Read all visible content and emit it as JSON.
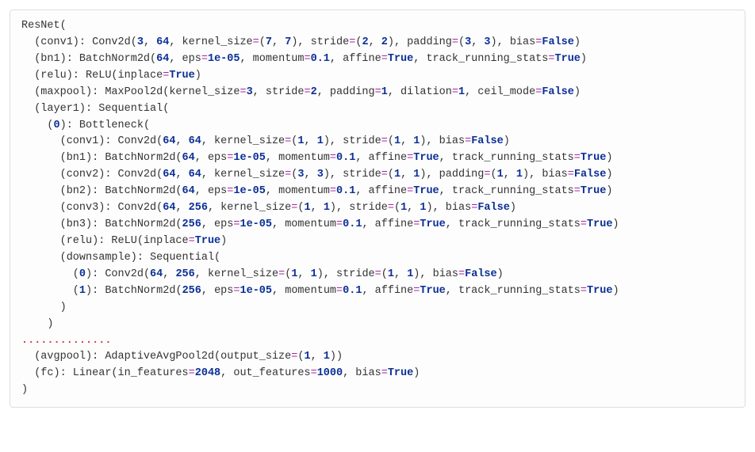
{
  "model": "ResNet",
  "lines": [
    {
      "indent": 0,
      "tokens": [
        [
          "ResNet(",
          ""
        ]
      ]
    },
    {
      "indent": 1,
      "tokens": [
        [
          "(conv1): Conv2d(",
          ""
        ],
        [
          "3",
          "n"
        ],
        [
          ", ",
          ""
        ],
        [
          "64",
          "n"
        ],
        [
          ", kernel_size",
          ""
        ],
        [
          "=",
          "op"
        ],
        [
          "(",
          ""
        ],
        [
          "7",
          "n"
        ],
        [
          ", ",
          ""
        ],
        [
          "7",
          "n"
        ],
        [
          "), stride",
          ""
        ],
        [
          "=",
          "op"
        ],
        [
          "(",
          ""
        ],
        [
          "2",
          "n"
        ],
        [
          ", ",
          ""
        ],
        [
          "2",
          "n"
        ],
        [
          "), padding",
          ""
        ],
        [
          "=",
          "op"
        ],
        [
          "(",
          ""
        ],
        [
          "3",
          "n"
        ],
        [
          ", ",
          ""
        ],
        [
          "3",
          "n"
        ],
        [
          "), bias",
          ""
        ],
        [
          "=",
          "op"
        ],
        [
          "False",
          "kw"
        ],
        [
          ")",
          ""
        ]
      ]
    },
    {
      "indent": 1,
      "tokens": [
        [
          "(bn1): BatchNorm2d(",
          ""
        ],
        [
          "64",
          "n"
        ],
        [
          ", eps",
          ""
        ],
        [
          "=",
          "op"
        ],
        [
          "1e-05",
          "n"
        ],
        [
          ", momentum",
          ""
        ],
        [
          "=",
          "op"
        ],
        [
          "0.1",
          "n"
        ],
        [
          ", affine",
          ""
        ],
        [
          "=",
          "op"
        ],
        [
          "True",
          "kw"
        ],
        [
          ", track_running_stats",
          ""
        ],
        [
          "=",
          "op"
        ],
        [
          "True",
          "kw"
        ],
        [
          ")",
          ""
        ]
      ]
    },
    {
      "indent": 1,
      "tokens": [
        [
          "(relu): ReLU(inplace",
          ""
        ],
        [
          "=",
          "op"
        ],
        [
          "True",
          "kw"
        ],
        [
          ")",
          ""
        ]
      ]
    },
    {
      "indent": 1,
      "tokens": [
        [
          "(maxpool): MaxPool2d(kernel_size",
          ""
        ],
        [
          "=",
          "op"
        ],
        [
          "3",
          "n"
        ],
        [
          ", stride",
          ""
        ],
        [
          "=",
          "op"
        ],
        [
          "2",
          "n"
        ],
        [
          ", padding",
          ""
        ],
        [
          "=",
          "op"
        ],
        [
          "1",
          "n"
        ],
        [
          ", dilation",
          ""
        ],
        [
          "=",
          "op"
        ],
        [
          "1",
          "n"
        ],
        [
          ", ceil_mode",
          ""
        ],
        [
          "=",
          "op"
        ],
        [
          "False",
          "kw"
        ],
        [
          ")",
          ""
        ]
      ]
    },
    {
      "indent": 1,
      "tokens": [
        [
          "(layer1): Sequential(",
          ""
        ]
      ]
    },
    {
      "indent": 2,
      "tokens": [
        [
          "(",
          ""
        ],
        [
          "0",
          "n"
        ],
        [
          "): Bottleneck(",
          ""
        ]
      ]
    },
    {
      "indent": 3,
      "tokens": [
        [
          "(conv1): Conv2d(",
          ""
        ],
        [
          "64",
          "n"
        ],
        [
          ", ",
          ""
        ],
        [
          "64",
          "n"
        ],
        [
          ", kernel_size",
          ""
        ],
        [
          "=",
          "op"
        ],
        [
          "(",
          ""
        ],
        [
          "1",
          "n"
        ],
        [
          ", ",
          ""
        ],
        [
          "1",
          "n"
        ],
        [
          "), stride",
          ""
        ],
        [
          "=",
          "op"
        ],
        [
          "(",
          ""
        ],
        [
          "1",
          "n"
        ],
        [
          ", ",
          ""
        ],
        [
          "1",
          "n"
        ],
        [
          "), bias",
          ""
        ],
        [
          "=",
          "op"
        ],
        [
          "False",
          "kw"
        ],
        [
          ")",
          ""
        ]
      ]
    },
    {
      "indent": 3,
      "tokens": [
        [
          "(bn1): BatchNorm2d(",
          ""
        ],
        [
          "64",
          "n"
        ],
        [
          ", eps",
          ""
        ],
        [
          "=",
          "op"
        ],
        [
          "1e-05",
          "n"
        ],
        [
          ", momentum",
          ""
        ],
        [
          "=",
          "op"
        ],
        [
          "0.1",
          "n"
        ],
        [
          ", affine",
          ""
        ],
        [
          "=",
          "op"
        ],
        [
          "True",
          "kw"
        ],
        [
          ", track_running_stats",
          ""
        ],
        [
          "=",
          "op"
        ],
        [
          "True",
          "kw"
        ],
        [
          ")",
          ""
        ]
      ]
    },
    {
      "indent": 3,
      "tokens": [
        [
          "(conv2): Conv2d(",
          ""
        ],
        [
          "64",
          "n"
        ],
        [
          ", ",
          ""
        ],
        [
          "64",
          "n"
        ],
        [
          ", kernel_size",
          ""
        ],
        [
          "=",
          "op"
        ],
        [
          "(",
          ""
        ],
        [
          "3",
          "n"
        ],
        [
          ", ",
          ""
        ],
        [
          "3",
          "n"
        ],
        [
          "), stride",
          ""
        ],
        [
          "=",
          "op"
        ],
        [
          "(",
          ""
        ],
        [
          "1",
          "n"
        ],
        [
          ", ",
          ""
        ],
        [
          "1",
          "n"
        ],
        [
          "), padding",
          ""
        ],
        [
          "=",
          "op"
        ],
        [
          "(",
          ""
        ],
        [
          "1",
          "n"
        ],
        [
          ", ",
          ""
        ],
        [
          "1",
          "n"
        ],
        [
          "), bias",
          ""
        ],
        [
          "=",
          "op"
        ],
        [
          "False",
          "kw"
        ],
        [
          ")",
          ""
        ]
      ]
    },
    {
      "indent": 3,
      "tokens": [
        [
          "(bn2): BatchNorm2d(",
          ""
        ],
        [
          "64",
          "n"
        ],
        [
          ", eps",
          ""
        ],
        [
          "=",
          "op"
        ],
        [
          "1e-05",
          "n"
        ],
        [
          ", momentum",
          ""
        ],
        [
          "=",
          "op"
        ],
        [
          "0.1",
          "n"
        ],
        [
          ", affine",
          ""
        ],
        [
          "=",
          "op"
        ],
        [
          "True",
          "kw"
        ],
        [
          ", track_running_stats",
          ""
        ],
        [
          "=",
          "op"
        ],
        [
          "True",
          "kw"
        ],
        [
          ")",
          ""
        ]
      ]
    },
    {
      "indent": 3,
      "tokens": [
        [
          "(conv3): Conv2d(",
          ""
        ],
        [
          "64",
          "n"
        ],
        [
          ", ",
          ""
        ],
        [
          "256",
          "n"
        ],
        [
          ", kernel_size",
          ""
        ],
        [
          "=",
          "op"
        ],
        [
          "(",
          ""
        ],
        [
          "1",
          "n"
        ],
        [
          ", ",
          ""
        ],
        [
          "1",
          "n"
        ],
        [
          "), stride",
          ""
        ],
        [
          "=",
          "op"
        ],
        [
          "(",
          ""
        ],
        [
          "1",
          "n"
        ],
        [
          ", ",
          ""
        ],
        [
          "1",
          "n"
        ],
        [
          "), bias",
          ""
        ],
        [
          "=",
          "op"
        ],
        [
          "False",
          "kw"
        ],
        [
          ")",
          ""
        ]
      ]
    },
    {
      "indent": 3,
      "tokens": [
        [
          "(bn3): BatchNorm2d(",
          ""
        ],
        [
          "256",
          "n"
        ],
        [
          ", eps",
          ""
        ],
        [
          "=",
          "op"
        ],
        [
          "1e-05",
          "n"
        ],
        [
          ", momentum",
          ""
        ],
        [
          "=",
          "op"
        ],
        [
          "0.1",
          "n"
        ],
        [
          ", affine",
          ""
        ],
        [
          "=",
          "op"
        ],
        [
          "True",
          "kw"
        ],
        [
          ", track_running_stats",
          ""
        ],
        [
          "=",
          "op"
        ],
        [
          "True",
          "kw"
        ],
        [
          ")",
          ""
        ]
      ]
    },
    {
      "indent": 3,
      "tokens": [
        [
          "(relu): ReLU(inplace",
          ""
        ],
        [
          "=",
          "op"
        ],
        [
          "True",
          "kw"
        ],
        [
          ")",
          ""
        ]
      ]
    },
    {
      "indent": 3,
      "tokens": [
        [
          "(downsample): Sequential(",
          ""
        ]
      ]
    },
    {
      "indent": 4,
      "tokens": [
        [
          "(",
          ""
        ],
        [
          "0",
          "n"
        ],
        [
          "): Conv2d(",
          ""
        ],
        [
          "64",
          "n"
        ],
        [
          ", ",
          ""
        ],
        [
          "256",
          "n"
        ],
        [
          ", kernel_size",
          ""
        ],
        [
          "=",
          "op"
        ],
        [
          "(",
          ""
        ],
        [
          "1",
          "n"
        ],
        [
          ", ",
          ""
        ],
        [
          "1",
          "n"
        ],
        [
          "), stride",
          ""
        ],
        [
          "=",
          "op"
        ],
        [
          "(",
          ""
        ],
        [
          "1",
          "n"
        ],
        [
          ", ",
          ""
        ],
        [
          "1",
          "n"
        ],
        [
          "), bias",
          ""
        ],
        [
          "=",
          "op"
        ],
        [
          "False",
          "kw"
        ],
        [
          ")",
          ""
        ]
      ]
    },
    {
      "indent": 4,
      "tokens": [
        [
          "(",
          ""
        ],
        [
          "1",
          "n"
        ],
        [
          "): BatchNorm2d(",
          ""
        ],
        [
          "256",
          "n"
        ],
        [
          ", eps",
          ""
        ],
        [
          "=",
          "op"
        ],
        [
          "1e-05",
          "n"
        ],
        [
          ", momentum",
          ""
        ],
        [
          "=",
          "op"
        ],
        [
          "0.1",
          "n"
        ],
        [
          ", affine",
          ""
        ],
        [
          "=",
          "op"
        ],
        [
          "True",
          "kw"
        ],
        [
          ", track_running_stats",
          ""
        ],
        [
          "=",
          "op"
        ],
        [
          "True",
          "kw"
        ],
        [
          ")",
          ""
        ]
      ]
    },
    {
      "indent": 3,
      "tokens": [
        [
          ")",
          ""
        ]
      ]
    },
    {
      "indent": 2,
      "tokens": [
        [
          ")",
          ""
        ]
      ]
    },
    {
      "indent": 0,
      "tokens": [
        [
          "..............",
          "dots"
        ]
      ]
    },
    {
      "indent": 1,
      "tokens": [
        [
          "(avgpool): AdaptiveAvgPool2d(output_size",
          ""
        ],
        [
          "=",
          "op"
        ],
        [
          "(",
          ""
        ],
        [
          "1",
          "n"
        ],
        [
          ", ",
          ""
        ],
        [
          "1",
          "n"
        ],
        [
          "))",
          ""
        ]
      ]
    },
    {
      "indent": 1,
      "tokens": [
        [
          "(fc): Linear(in_features",
          ""
        ],
        [
          "=",
          "op"
        ],
        [
          "2048",
          "n"
        ],
        [
          ", out_features",
          ""
        ],
        [
          "=",
          "op"
        ],
        [
          "1000",
          "n"
        ],
        [
          ", bias",
          ""
        ],
        [
          "=",
          "op"
        ],
        [
          "True",
          "kw"
        ],
        [
          ")",
          ""
        ]
      ]
    },
    {
      "indent": 0,
      "tokens": [
        [
          ")",
          ""
        ]
      ]
    }
  ]
}
